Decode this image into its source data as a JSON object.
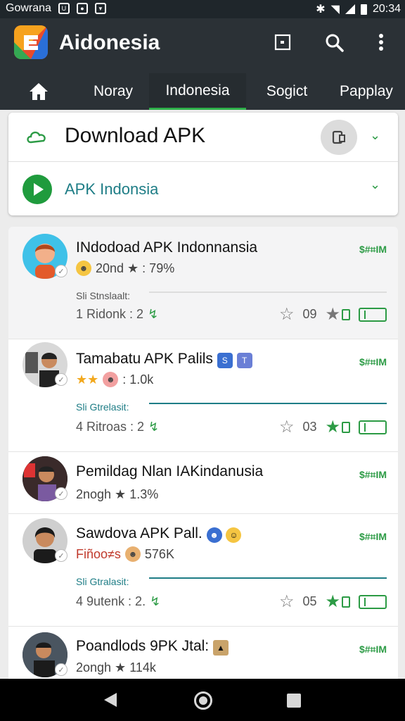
{
  "status_bar": {
    "carrier": "Gowrana",
    "time": "20:34"
  },
  "app": {
    "title": "Aidonesia"
  },
  "tabs": [
    {
      "label": "Noray"
    },
    {
      "label": "Indonesia"
    },
    {
      "label": "Sogict"
    },
    {
      "label": "Papplay"
    }
  ],
  "download_card": {
    "title": "Download APK",
    "subtitle": "APK Indonsia"
  },
  "items": [
    {
      "title": "INdodoad APK Indonnansia",
      "price": "$#⌗IM",
      "meta": "20nd ★ : 79%",
      "section": "Sli Stnslaalt:",
      "stats": "1 Ridonk : 2",
      "count": "09"
    },
    {
      "title": "Tamabatu APK Palils",
      "price": "$#⌗IM",
      "meta": ": 1.0k",
      "section": "Sli Gtrelasit:",
      "stats": "4 Ritroas : 2",
      "count": "03"
    },
    {
      "title": "Pemildag Nlan IAKindanusia",
      "price": "$#⌗IM",
      "meta": "2nogh ★ 1.3%"
    },
    {
      "title": "Sawdova APK Pall.",
      "price": "$#⌗IM",
      "meta": "Fiñoo≠s",
      "meta2": "576K",
      "section": "Sli Gtralasit:",
      "stats": "4 9utenk : 2.",
      "count": "05"
    },
    {
      "title": "Poandlods 9PK Jtal:",
      "price": "$#⌗IM",
      "meta": "2ongh ★ 114k"
    }
  ],
  "colors": {
    "accent": "#2c9b45",
    "appbar": "#2b3136",
    "teal": "#1e7d86"
  }
}
